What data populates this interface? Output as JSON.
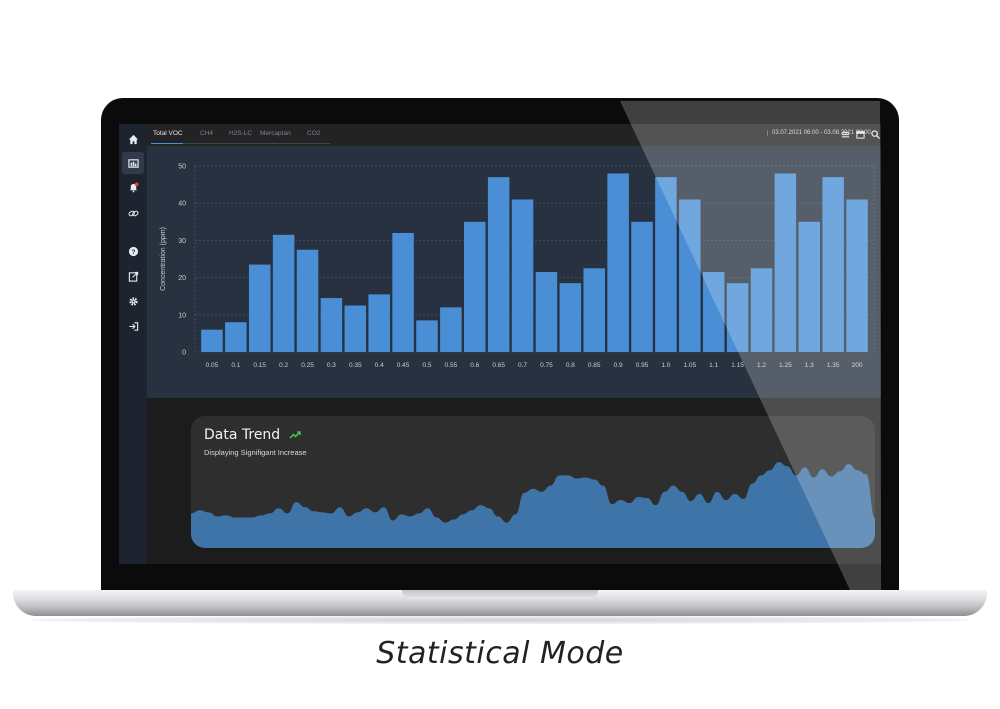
{
  "tabs": [
    {
      "label": "Total VOC",
      "active": true
    },
    {
      "label": "CH4",
      "active": false
    },
    {
      "label": "H2S-LC",
      "active": false
    },
    {
      "label": "Mercaptan",
      "active": false
    },
    {
      "label": "CO2",
      "active": false
    }
  ],
  "date_range": "03.07.2021 06:00 - 03.08.2021 00:00",
  "sidebar_icons": [
    "home-icon",
    "dashboard-icon",
    "bell-icon",
    "link-icon",
    "help-icon",
    "export-icon",
    "settings-icon",
    "logout-icon"
  ],
  "colors": {
    "bar": "#4a8fd6",
    "panel": "#273140",
    "trend_fill": "#3f74a8",
    "accent_green": "#3cc25a"
  },
  "chart_data": {
    "type": "bar",
    "ylabel": "Concentration (ppm)",
    "ylim": [
      0,
      50
    ],
    "yticks": [
      0,
      10,
      20,
      30,
      40,
      50
    ],
    "categories": [
      "0.05",
      "0.1",
      "0.15",
      "0.2",
      "0.25",
      "0.3",
      "0.35",
      "0.4",
      "0.45",
      "0.5",
      "0.55",
      "0.6",
      "0.65",
      "0.7",
      "0.75",
      "0.8",
      "0.85",
      "0.9",
      "0.95",
      "1.0",
      "1.05",
      "1.1",
      "1.15",
      "1.2",
      "1.25",
      "1.3",
      "1.35",
      "200"
    ],
    "values": [
      6,
      8,
      23.5,
      31.5,
      27.5,
      14.5,
      12.5,
      15.5,
      32,
      8.5,
      12,
      35,
      47,
      41,
      21.5,
      18.5,
      22.5,
      48,
      35,
      47,
      41,
      21.5,
      18.5,
      22.5,
      48,
      35,
      47,
      41
    ],
    "grid": "dashed",
    "legend": "none"
  },
  "trend": {
    "title": "Data Trend",
    "subtitle": "Displaying Signifigant Increase",
    "values": [
      26,
      29,
      27,
      23,
      24,
      22,
      22,
      22,
      24,
      26,
      31,
      26,
      37,
      32,
      28,
      27,
      26,
      32,
      23,
      27,
      31,
      27,
      32,
      19,
      25,
      23,
      26,
      31,
      22,
      17,
      20,
      25,
      29,
      34,
      31,
      23,
      17,
      25,
      46,
      50,
      47,
      53,
      63,
      63,
      60,
      61,
      59,
      53,
      35,
      39,
      36,
      42,
      41,
      34,
      47,
      53,
      47,
      38,
      45,
      36,
      47,
      39,
      45,
      40,
      55,
      63,
      68,
      76,
      72,
      63,
      71,
      61,
      69,
      62,
      67,
      74,
      68,
      64,
      21
    ]
  },
  "caption": "Statistical Mode"
}
